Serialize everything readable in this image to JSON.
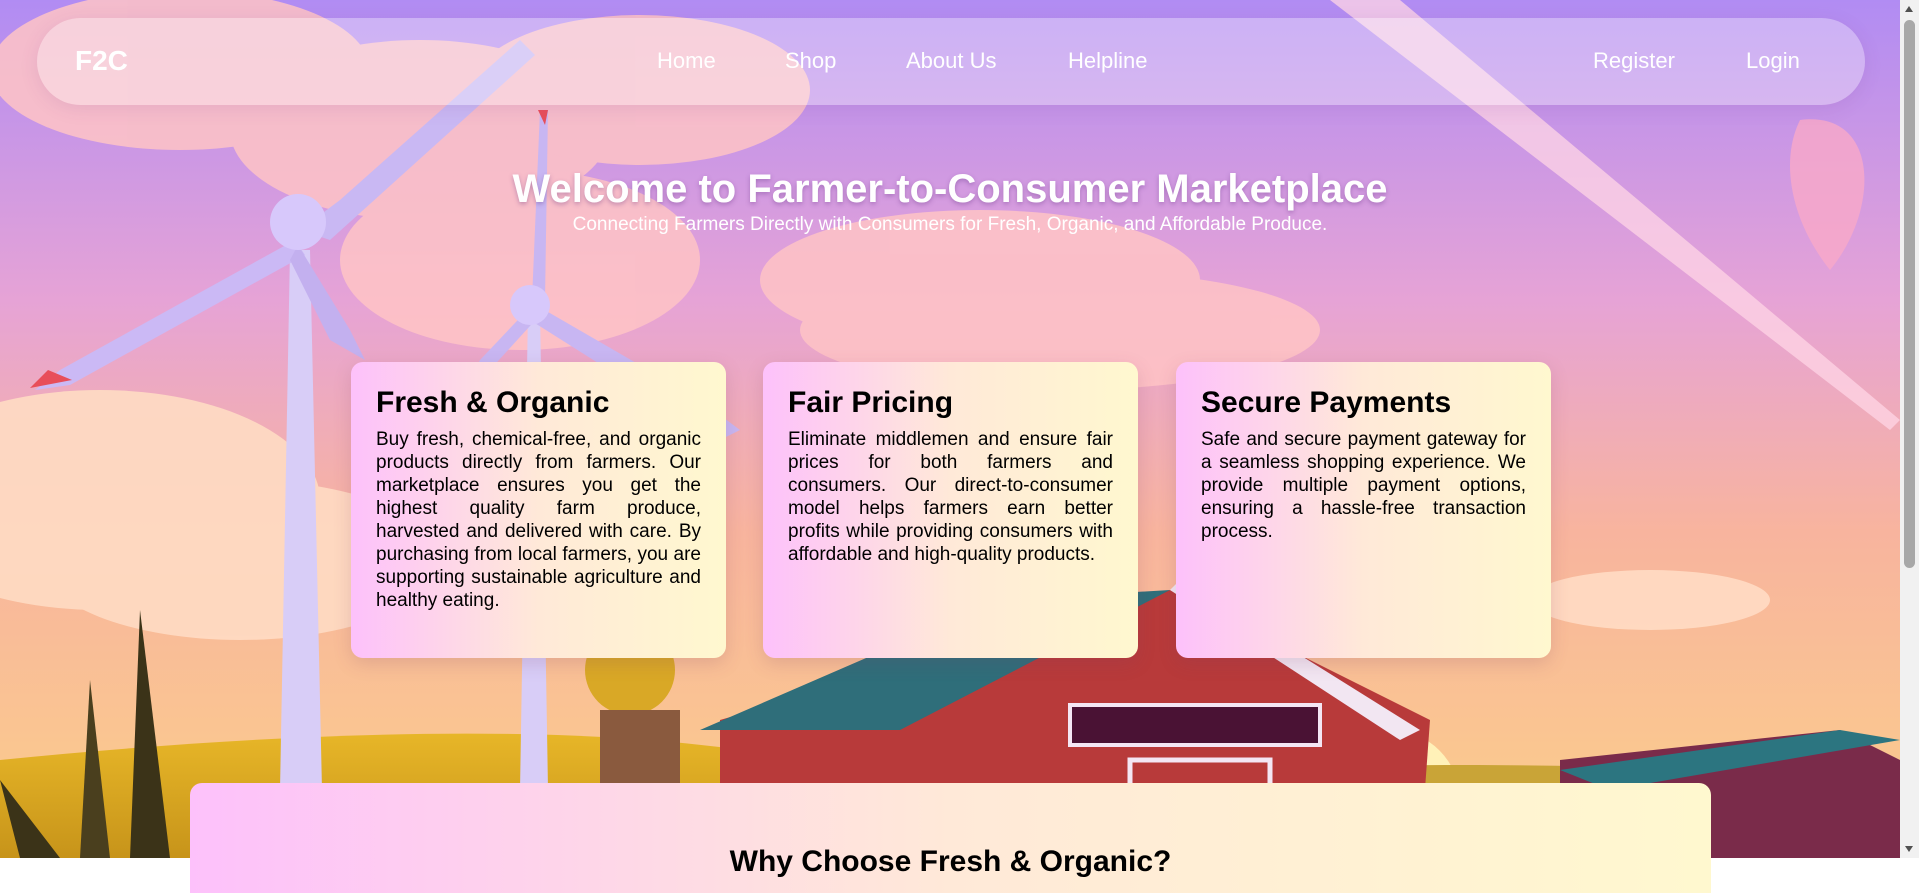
{
  "brand": "F2C",
  "nav": {
    "home": "Home",
    "shop": "Shop",
    "about": "About Us",
    "helpline": "Helpline",
    "register": "Register",
    "login": "Login"
  },
  "hero": {
    "title": "Welcome to Farmer-to-Consumer Marketplace",
    "subtitle": "Connecting Farmers Directly with Consumers for Fresh, Organic, and Affordable Produce."
  },
  "cards": [
    {
      "title": "Fresh & Organic",
      "text": "Buy fresh, chemical-free, and organic products directly from farmers. Our marketplace ensures you get the highest quality farm produce, harvested and delivered with care. By purchasing from local farmers, you are supporting sustainable agriculture and healthy eating."
    },
    {
      "title": "Fair Pricing",
      "text": "Eliminate middlemen and ensure fair prices for both farmers and consumers. Our direct-to-consumer model helps farmers earn better profits while providing consumers with affordable and high-quality products."
    },
    {
      "title": "Secure Payments",
      "text": "Safe and secure payment gateway for a seamless shopping experience. We provide multiple payment options, ensuring a hassle-free transaction process."
    }
  ],
  "why": {
    "title": "Why Choose Fresh & Organic?"
  },
  "icons": {
    "background": "farm-landscape-illustration",
    "scroll_up": "scroll-up-arrow-icon",
    "scroll_down": "scroll-down-arrow-icon"
  },
  "colors": {
    "card_gradient_start": "#fdc1fb",
    "card_gradient_mid": "#ffe9d8",
    "card_gradient_end": "#fff8cf",
    "sky_top": "#b48cf2",
    "sky_bottom": "#f9b98a",
    "nav_text": "#ffffff"
  }
}
